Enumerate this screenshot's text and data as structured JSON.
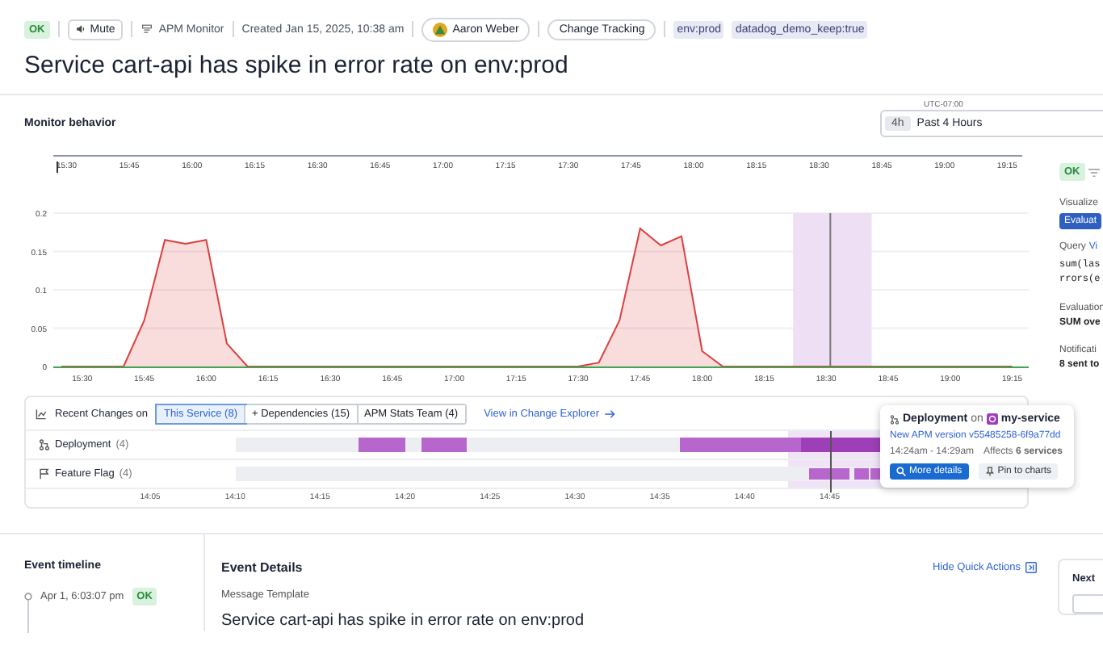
{
  "header": {
    "status": "OK",
    "mute": "Mute",
    "monitor_type": "APM Monitor",
    "created": "Created Jan 15, 2025, 10:38 am",
    "owner": "Aaron Weber",
    "change_tracking": "Change Tracking",
    "tags": [
      "env:prod",
      "datadog_demo_keep:true"
    ]
  },
  "title": "Service cart-api has spike in error rate on env:prod",
  "monitor_behavior": {
    "label": "Monitor behavior",
    "time_picker": {
      "timezone": "UTC-07:00",
      "chip": "4h",
      "value": "Past 4 Hours"
    },
    "overview_axis": [
      "15:30",
      "15:45",
      "16:00",
      "16:15",
      "16:30",
      "16:45",
      "17:00",
      "17:15",
      "17:30",
      "17:45",
      "18:00",
      "18:15",
      "18:30",
      "18:45",
      "19:00",
      "19:15"
    ],
    "chart_data": {
      "type": "area",
      "categories": [
        null,
        "15:30",
        null,
        null,
        "15:45",
        null,
        null,
        "16:00",
        null,
        null,
        "16:15",
        null,
        null,
        "16:30",
        null,
        null,
        "16:45",
        null,
        null,
        "17:00",
        null,
        null,
        "17:15",
        null,
        null,
        "17:30",
        null,
        null,
        "17:45",
        null,
        null,
        "18:00",
        null,
        null,
        "18:15",
        null,
        null,
        "18:30",
        null,
        null,
        "18:45",
        null,
        null,
        "19:00",
        null,
        null,
        "19:15"
      ],
      "series": [
        {
          "color": "#dc3f3f",
          "values": [
            0,
            0,
            0,
            0,
            0.06,
            0.165,
            0.16,
            0.165,
            0.03,
            0,
            0,
            0,
            0,
            0,
            0,
            0,
            0,
            0,
            0,
            0,
            0,
            0,
            0,
            0,
            0,
            0,
            0.005,
            0.06,
            0.18,
            0.158,
            0.17,
            0.02,
            0,
            0,
            0,
            0,
            0,
            0,
            0,
            0,
            0,
            0,
            0,
            0,
            0,
            0,
            0
          ]
        }
      ],
      "ylim": [
        0,
        0.2
      ],
      "grid": true,
      "yticks": [
        0,
        0.05,
        0.1,
        0.15,
        0.2
      ]
    }
  },
  "side_panel": {
    "status": "OK",
    "visualize_label": "Visualize",
    "evaluate_button": "Evaluat",
    "query_label": "Query",
    "query_link": "Vi",
    "query_lines": [
      "sum(las",
      "rrors(e"
    ],
    "evaluation_label": "Evaluation",
    "evaluation_value": "SUM ove",
    "notifications_label": "Notificati",
    "notifications_value": "8 sent to"
  },
  "recent_changes": {
    "label": "Recent Changes on",
    "tabs": [
      {
        "label": "This Service (8)",
        "selected": true
      },
      {
        "label": "+ Dependencies (15)",
        "selected": false
      },
      {
        "label": "APM Stats Team (4)",
        "selected": false
      }
    ],
    "link": "View in Change Explorer",
    "rows": [
      {
        "kind": "deployment",
        "label": "Deployment",
        "count": "(4)"
      },
      {
        "kind": "flag",
        "label": "Feature Flag",
        "count": "(4)"
      }
    ],
    "ticks": [
      "14:05",
      "14:10",
      "14:15",
      "14:20",
      "14:25",
      "14:30",
      "14:35",
      "14:40",
      "14:45"
    ],
    "popup": {
      "kind": "Deployment",
      "on": "on",
      "service": "my-service",
      "link": "New APM version v55485258-6f9a77dd",
      "time": "14:24am - 14:29am",
      "affects": "Affects **6 services**",
      "buttons": [
        "More details",
        "Pin to charts"
      ]
    }
  },
  "event_timeline": {
    "title": "Event timeline",
    "events": [
      {
        "time": "Apr 1, 6:03:07 pm",
        "status": "OK"
      }
    ]
  },
  "event_details": {
    "title": "Event Details",
    "quick_actions": "Hide Quick Actions",
    "template_label": "Message Template",
    "message": "Service cart-api has spike in error rate on env:prod"
  },
  "next_panel": {
    "title": "Next"
  }
}
